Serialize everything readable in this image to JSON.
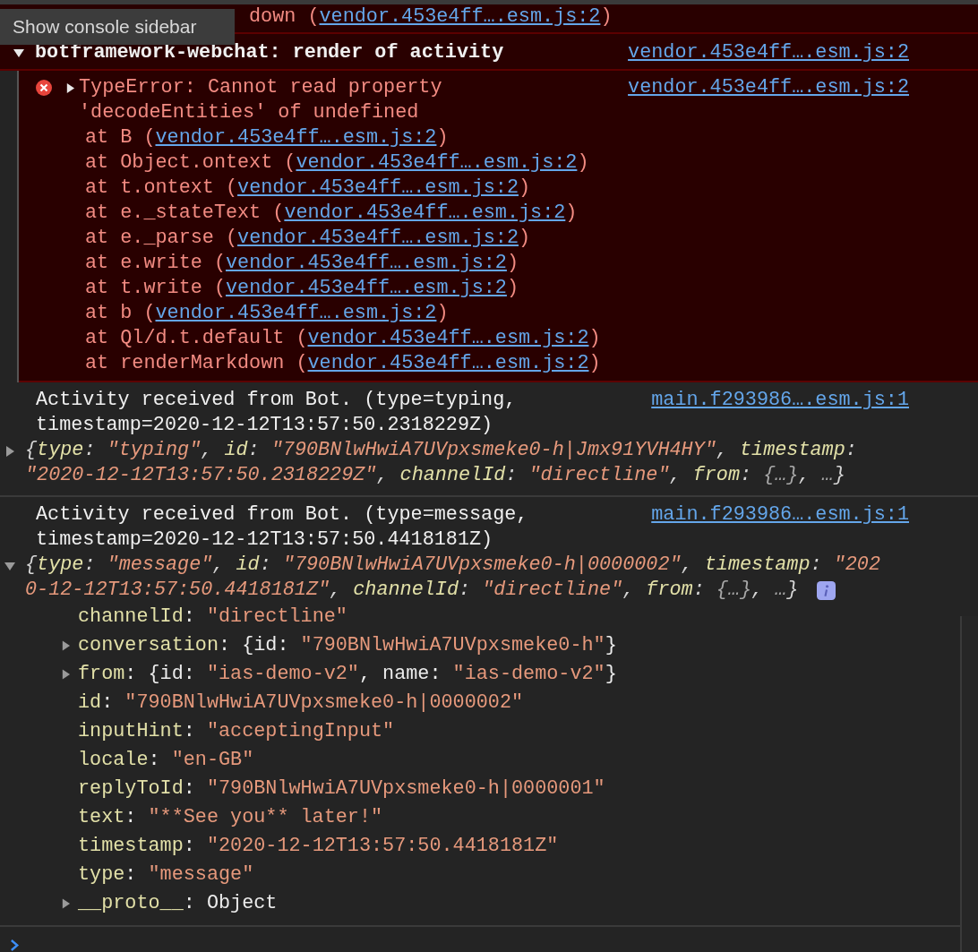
{
  "tooltip": "Show console sidebar",
  "top_stack_line": {
    "text": "down (",
    "link": "vendor.453e4ff….esm.js:2",
    "end": ")"
  },
  "group": {
    "expanded": true,
    "title": "botframework-webchat: render of activity",
    "source": "vendor.453e4ff….esm.js:2"
  },
  "error": {
    "expanded": false,
    "message": "TypeError: Cannot read property 'decodeEntities' of undefined",
    "source": "vendor.453e4ff….esm.js:2",
    "stack": [
      {
        "text": "at B (",
        "link": "vendor.453e4ff….esm.js:2",
        "end": ")"
      },
      {
        "text": "at Object.ontext (",
        "link": "vendor.453e4ff….esm.js:2",
        "end": ")"
      },
      {
        "text": "at t.ontext (",
        "link": "vendor.453e4ff….esm.js:2",
        "end": ")"
      },
      {
        "text": "at e._stateText (",
        "link": "vendor.453e4ff….esm.js:2",
        "end": ")"
      },
      {
        "text": "at e._parse (",
        "link": "vendor.453e4ff….esm.js:2",
        "end": ")"
      },
      {
        "text": "at e.write (",
        "link": "vendor.453e4ff….esm.js:2",
        "end": ")"
      },
      {
        "text": "at t.write (",
        "link": "vendor.453e4ff….esm.js:2",
        "end": ")"
      },
      {
        "text": "at b (",
        "link": "vendor.453e4ff….esm.js:2",
        "end": ")"
      },
      {
        "text": "at Ql/d.t.default (",
        "link": "vendor.453e4ff….esm.js:2",
        "end": ")"
      },
      {
        "text": "at renderMarkdown (",
        "link": "vendor.453e4ff….esm.js:2",
        "end": ")"
      }
    ]
  },
  "logs": [
    {
      "message": "Activity received from Bot. (type=typing, timestamp=2020-12-12T13:57:50.2318229Z)",
      "source": "main.f293986….esm.js:1",
      "expanded": false,
      "info_badge": false,
      "preview": [
        {
          "kind": "punct",
          "text": "{"
        },
        {
          "kind": "key",
          "text": "type"
        },
        {
          "kind": "punct",
          "text": ": "
        },
        {
          "kind": "string",
          "text": "\"typing\""
        },
        {
          "kind": "punct",
          "text": ", "
        },
        {
          "kind": "key",
          "text": "id"
        },
        {
          "kind": "punct",
          "text": ": "
        },
        {
          "kind": "string",
          "text": "\"790BNlwHwiA7UVpxsmeke0-h|Jmx91YVH4HY\""
        },
        {
          "kind": "punct",
          "text": ", "
        },
        {
          "kind": "key",
          "text": "timestamp"
        },
        {
          "kind": "punct",
          "text": ": "
        },
        {
          "kind": "string",
          "text": "\"2020-12-12T13:57:50.2318229Z\""
        },
        {
          "kind": "punct",
          "text": ", "
        },
        {
          "kind": "key",
          "text": "channelId"
        },
        {
          "kind": "punct",
          "text": ": "
        },
        {
          "kind": "string",
          "text": "\"directline\""
        },
        {
          "kind": "punct",
          "text": ", "
        },
        {
          "kind": "key",
          "text": "from"
        },
        {
          "kind": "punct",
          "text": ": "
        },
        {
          "kind": "muted",
          "text": "{…}"
        },
        {
          "kind": "punct",
          "text": ", "
        },
        {
          "kind": "muted",
          "text": "…"
        },
        {
          "kind": "punct",
          "text": "}"
        }
      ]
    },
    {
      "message": "Activity received from Bot. (type=message, timestamp=2020-12-12T13:57:50.4418181Z)",
      "source": "main.f293986….esm.js:1",
      "expanded": true,
      "info_badge": true,
      "preview": [
        {
          "kind": "punct",
          "text": "{"
        },
        {
          "kind": "key",
          "text": "type"
        },
        {
          "kind": "punct",
          "text": ": "
        },
        {
          "kind": "string",
          "text": "\"message\""
        },
        {
          "kind": "punct",
          "text": ", "
        },
        {
          "kind": "key",
          "text": "id"
        },
        {
          "kind": "punct",
          "text": ": "
        },
        {
          "kind": "string",
          "text": "\"790BNlwHwiA7UVpxsmeke0-h|0000002\""
        },
        {
          "kind": "punct",
          "text": ", "
        },
        {
          "kind": "key",
          "text": "timestamp"
        },
        {
          "kind": "punct",
          "text": ": "
        },
        {
          "kind": "string",
          "text": "\"2020-12-12T13:57:50.4418181Z\""
        },
        {
          "kind": "punct",
          "text": ", "
        },
        {
          "kind": "key",
          "text": "channelId"
        },
        {
          "kind": "punct",
          "text": ": "
        },
        {
          "kind": "string",
          "text": "\"directline\""
        },
        {
          "kind": "punct",
          "text": ", "
        },
        {
          "kind": "key",
          "text": "from"
        },
        {
          "kind": "punct",
          "text": ": "
        },
        {
          "kind": "muted",
          "text": "{…}"
        },
        {
          "kind": "punct",
          "text": ", "
        },
        {
          "kind": "muted",
          "text": "…"
        },
        {
          "kind": "punct",
          "text": "}"
        }
      ],
      "properties": [
        {
          "expandable": false,
          "key": "channelId",
          "sep": ": ",
          "value": [
            {
              "kind": "string",
              "text": "\"directline\""
            }
          ]
        },
        {
          "expandable": true,
          "key": "conversation",
          "sep": ": ",
          "value": [
            {
              "kind": "plain",
              "text": "{id: "
            },
            {
              "kind": "string",
              "text": "\"790BNlwHwiA7UVpxsmeke0-h\""
            },
            {
              "kind": "plain",
              "text": "}"
            }
          ]
        },
        {
          "expandable": true,
          "key": "from",
          "sep": ": ",
          "value": [
            {
              "kind": "plain",
              "text": "{id: "
            },
            {
              "kind": "string",
              "text": "\"ias-demo-v2\""
            },
            {
              "kind": "plain",
              "text": ", name: "
            },
            {
              "kind": "string",
              "text": "\"ias-demo-v2\""
            },
            {
              "kind": "plain",
              "text": "}"
            }
          ]
        },
        {
          "expandable": false,
          "key": "id",
          "sep": ": ",
          "value": [
            {
              "kind": "string",
              "text": "\"790BNlwHwiA7UVpxsmeke0-h|0000002\""
            }
          ]
        },
        {
          "expandable": false,
          "key": "inputHint",
          "sep": ": ",
          "value": [
            {
              "kind": "string",
              "text": "\"acceptingInput\""
            }
          ]
        },
        {
          "expandable": false,
          "key": "locale",
          "sep": ": ",
          "value": [
            {
              "kind": "string",
              "text": "\"en-GB\""
            }
          ]
        },
        {
          "expandable": false,
          "key": "replyToId",
          "sep": ": ",
          "value": [
            {
              "kind": "string",
              "text": "\"790BNlwHwiA7UVpxsmeke0-h|0000001\""
            }
          ]
        },
        {
          "expandable": false,
          "key": "text",
          "sep": ": ",
          "value": [
            {
              "kind": "string",
              "text": "\"**See you** later!\""
            }
          ]
        },
        {
          "expandable": false,
          "key": "timestamp",
          "sep": ": ",
          "value": [
            {
              "kind": "string",
              "text": "\"2020-12-12T13:57:50.4418181Z\""
            }
          ]
        },
        {
          "expandable": false,
          "key": "type",
          "sep": ": ",
          "value": [
            {
              "kind": "string",
              "text": "\"message\""
            }
          ]
        },
        {
          "expandable": true,
          "key": "__proto__",
          "sep": ": ",
          "value": [
            {
              "kind": "plain",
              "text": "Object"
            }
          ]
        }
      ]
    }
  ]
}
